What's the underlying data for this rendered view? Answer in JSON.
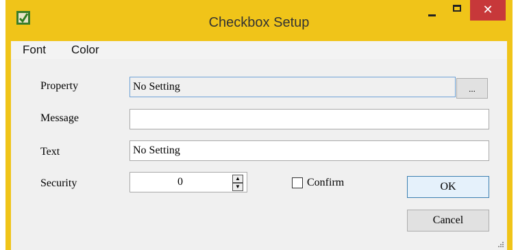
{
  "window": {
    "title": "Checkbox Setup",
    "close_glyph": "✕"
  },
  "menu": {
    "items": [
      {
        "label": "Font"
      },
      {
        "label": "Color"
      }
    ]
  },
  "form": {
    "property": {
      "label": "Property",
      "value": "No Setting",
      "browse_label": "..."
    },
    "message": {
      "label": "Message",
      "value": ""
    },
    "text": {
      "label": "Text",
      "value": "No Setting"
    },
    "security": {
      "label": "Security",
      "value": "0"
    },
    "confirm": {
      "label": "Confirm",
      "checked": false
    }
  },
  "buttons": {
    "ok": "OK",
    "cancel": "Cancel"
  }
}
